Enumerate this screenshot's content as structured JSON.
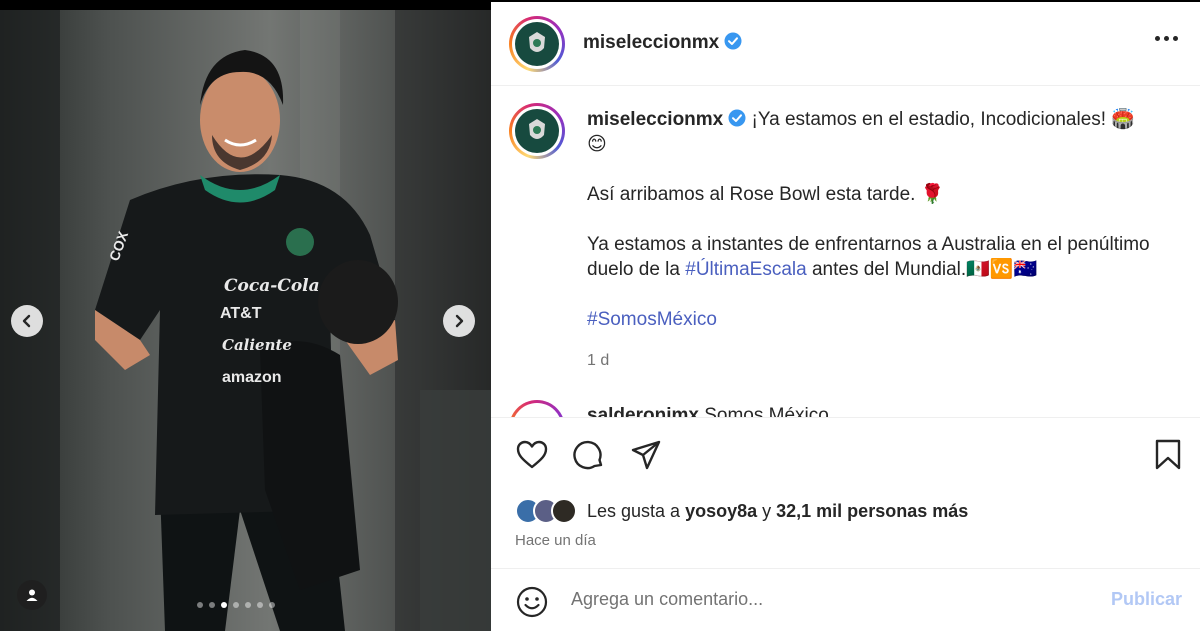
{
  "post": {
    "username": "miseleccionmx",
    "caption_username": "miseleccionmx",
    "caption_lines": [
      "¡Ya estamos en el estadio, Incodicionales! 🏟️ 😊",
      "Así arribamos al Rose Bowl esta tarde. 🌹"
    ],
    "caption_para3_before": "Ya estamos a instantes de enfrentarnos a Australia en el penúltimo duelo de la ",
    "caption_para3_hashtag": "#ÚltimaEscala",
    "caption_para3_after": " antes del Mundial.🇲🇽🆚🇦🇺",
    "caption_hashtag": "#SomosMéxico",
    "time_ago": "1 d",
    "next_comment_username": "salderonimx",
    "next_comment_text": "Somos México"
  },
  "engagement": {
    "likes_prefix": "Les gusta a ",
    "likes_user": "yosoy8a",
    "likes_mid": " y ",
    "likes_count": "32,1 mil personas más",
    "posted_when": "Hace un día"
  },
  "comment_box": {
    "placeholder": "Agrega un comentario...",
    "publish_label": "Publicar"
  },
  "carousel": {
    "total_slides": 7,
    "active_slide": 3
  },
  "jersey_text": {
    "sponsor1": "Coca-Cola",
    "sponsor2": "AT&T",
    "sponsor3": "Caliente",
    "sponsor4": "amazon",
    "sleeve": "COX"
  },
  "icons": {
    "prev": "chevron-left-icon",
    "next": "chevron-right-icon",
    "more": "more-horizontal-icon",
    "like": "heart-icon",
    "comment": "comment-icon",
    "share": "send-icon",
    "save": "bookmark-icon",
    "emoji": "emoji-icon",
    "tag": "user-tag-icon",
    "verified": "verified-badge-icon"
  },
  "colors": {
    "link": "#4a5fbf",
    "verified": "#3897f0",
    "publish_disabled": "#b2c8f5",
    "muted_text": "#737373"
  }
}
